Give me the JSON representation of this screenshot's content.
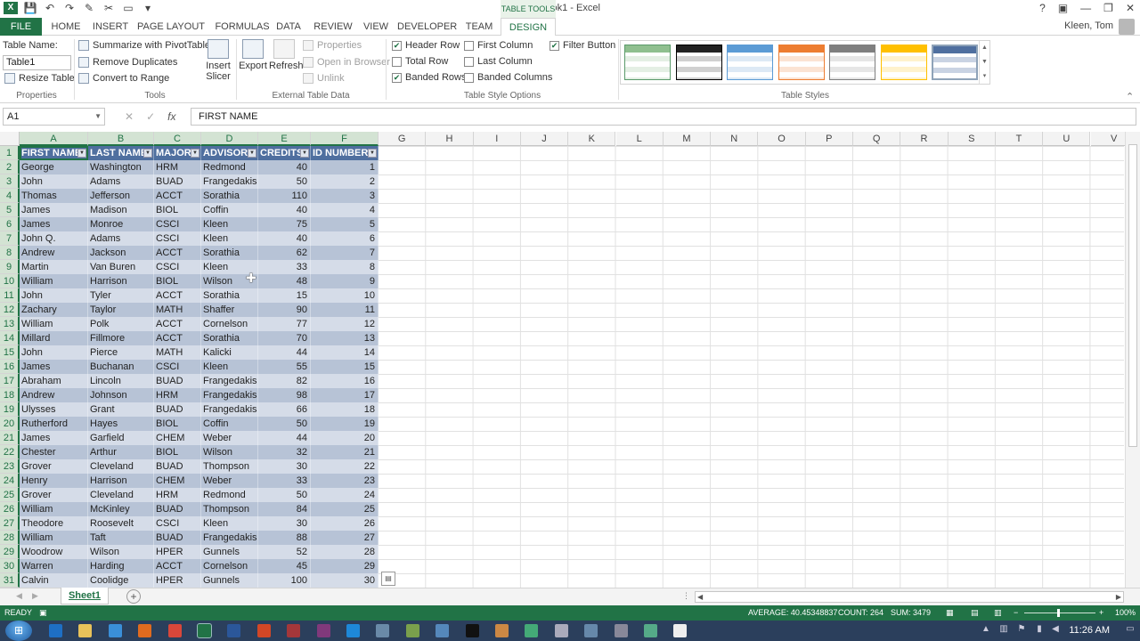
{
  "window": {
    "title": "Book1 - Excel",
    "context_group": "TABLE TOOLS",
    "user": "Kleen, Tom",
    "controls": [
      "?",
      "▣",
      "—",
      "❐",
      "✕"
    ]
  },
  "ribbon_tabs": [
    "FILE",
    "HOME",
    "INSERT",
    "PAGE LAYOUT",
    "FORMULAS",
    "DATA",
    "REVIEW",
    "VIEW",
    "DEVELOPER",
    "TEAM",
    "DESIGN"
  ],
  "active_tab": "DESIGN",
  "ribbon": {
    "properties": {
      "table_name_label": "Table Name:",
      "table_name_value": "Table1",
      "resize_label": "Resize Table",
      "group_label": "Properties"
    },
    "tools": {
      "summarize": "Summarize with PivotTable",
      "remove_duplicates": "Remove Duplicates",
      "convert": "Convert to Range",
      "insert_slicer": "Insert Slicer",
      "group_label": "Tools"
    },
    "external": {
      "export": "Export",
      "refresh": "Refresh",
      "properties": "Properties",
      "open_browser": "Open in Browser",
      "unlink": "Unlink",
      "group_label": "External Table Data"
    },
    "style_options": {
      "header_row": "Header Row",
      "total_row": "Total Row",
      "banded_rows": "Banded Rows",
      "first_column": "First Column",
      "last_column": "Last Column",
      "banded_columns": "Banded Columns",
      "filter_button": "Filter Button",
      "checked": {
        "header_row": true,
        "total_row": false,
        "banded_rows": true,
        "first_column": false,
        "last_column": false,
        "banded_columns": false,
        "filter_button": true
      },
      "group_label": "Table Style Options"
    },
    "table_styles": {
      "group_label": "Table Styles",
      "swatches": [
        {
          "head": "#8fbf8f",
          "band": "#e4efe4",
          "line": "#5a9a6a",
          "selected": false
        },
        {
          "head": "#222222",
          "band": "#d0d0d0",
          "line": "#000000",
          "selected": false
        },
        {
          "head": "#5b9bd5",
          "band": "#dde9f5",
          "line": "#5b9bd5",
          "selected": false
        },
        {
          "head": "#ed7d31",
          "band": "#fbe3d3",
          "line": "#ed7d31",
          "selected": false
        },
        {
          "head": "#7f7f7f",
          "band": "#e6e6e6",
          "line": "#7f7f7f",
          "selected": false
        },
        {
          "head": "#ffc000",
          "band": "#fff2cc",
          "line": "#ffc000",
          "selected": false
        },
        {
          "head": "#4f6f9f",
          "band": "#c9d3e3",
          "line": "#4f6f9f",
          "selected": true
        }
      ]
    }
  },
  "formula_bar": {
    "name_box": "A1",
    "formula": "FIRST NAME"
  },
  "columns": [
    "A",
    "B",
    "C",
    "D",
    "E",
    "F",
    "G",
    "H",
    "I",
    "J",
    "K",
    "L",
    "M",
    "N",
    "O",
    "P",
    "Q",
    "R",
    "S",
    "T",
    "U",
    "V"
  ],
  "table": {
    "headers": [
      "FIRST NAME",
      "LAST NAME",
      "MAJOR",
      "ADVISOR",
      "CREDITS",
      "ID NUMBER"
    ],
    "rows": [
      [
        "George",
        "Washington",
        "HRM",
        "Redmond",
        "40",
        "1"
      ],
      [
        "John",
        "Adams",
        "BUAD",
        "Frangedakis",
        "50",
        "2"
      ],
      [
        "Thomas",
        "Jefferson",
        "ACCT",
        "Sorathia",
        "110",
        "3"
      ],
      [
        "James",
        "Madison",
        "BIOL",
        "Coffin",
        "40",
        "4"
      ],
      [
        "James",
        "Monroe",
        "CSCI",
        "Kleen",
        "75",
        "5"
      ],
      [
        "John Q.",
        "Adams",
        "CSCI",
        "Kleen",
        "40",
        "6"
      ],
      [
        "Andrew",
        "Jackson",
        "ACCT",
        "Sorathia",
        "62",
        "7"
      ],
      [
        "Martin",
        "Van Buren",
        "CSCI",
        "Kleen",
        "33",
        "8"
      ],
      [
        "William",
        "Harrison",
        "BIOL",
        "Wilson",
        "48",
        "9"
      ],
      [
        "John",
        "Tyler",
        "ACCT",
        "Sorathia",
        "15",
        "10"
      ],
      [
        "Zachary",
        "Taylor",
        "MATH",
        "Shaffer",
        "90",
        "11"
      ],
      [
        "William",
        "Polk",
        "ACCT",
        "Cornelson",
        "77",
        "12"
      ],
      [
        "Millard",
        "Fillmore",
        "ACCT",
        "Sorathia",
        "70",
        "13"
      ],
      [
        "John",
        "Pierce",
        "MATH",
        "Kalicki",
        "44",
        "14"
      ],
      [
        "James",
        "Buchanan",
        "CSCI",
        "Kleen",
        "55",
        "15"
      ],
      [
        "Abraham",
        "Lincoln",
        "BUAD",
        "Frangedakis",
        "82",
        "16"
      ],
      [
        "Andrew",
        "Johnson",
        "HRM",
        "Frangedakis",
        "98",
        "17"
      ],
      [
        "Ulysses",
        "Grant",
        "BUAD",
        "Frangedakis",
        "66",
        "18"
      ],
      [
        "Rutherford",
        "Hayes",
        "BIOL",
        "Coffin",
        "50",
        "19"
      ],
      [
        "James",
        "Garfield",
        "CHEM",
        "Weber",
        "44",
        "20"
      ],
      [
        "Chester",
        "Arthur",
        "BIOL",
        "Wilson",
        "32",
        "21"
      ],
      [
        "Grover",
        "Cleveland",
        "BUAD",
        "Thompson",
        "30",
        "22"
      ],
      [
        "Henry",
        "Harrison",
        "CHEM",
        "Weber",
        "33",
        "23"
      ],
      [
        "Grover",
        "Cleveland",
        "HRM",
        "Redmond",
        "50",
        "24"
      ],
      [
        "William",
        "McKinley",
        "BUAD",
        "Thompson",
        "84",
        "25"
      ],
      [
        "Theodore",
        "Roosevelt",
        "CSCI",
        "Kleen",
        "30",
        "26"
      ],
      [
        "William",
        "Taft",
        "BUAD",
        "Frangedakis",
        "88",
        "27"
      ],
      [
        "Woodrow",
        "Wilson",
        "HPER",
        "Gunnels",
        "52",
        "28"
      ],
      [
        "Warren",
        "Harding",
        "ACCT",
        "Cornelson",
        "45",
        "29"
      ],
      [
        "Calvin",
        "Coolidge",
        "HPER",
        "Gunnels",
        "100",
        "30"
      ]
    ]
  },
  "sheet_tabs": [
    "Sheet1"
  ],
  "status": {
    "mode": "READY",
    "average": "AVERAGE: 40.45348837",
    "count": "COUNT: 264",
    "sum": "SUM: 3479",
    "zoom": "100%"
  },
  "taskbar": {
    "clock": "11:26 AM",
    "icons": [
      {
        "name": "outlook",
        "color": "#1e6fc4"
      },
      {
        "name": "folder",
        "color": "#e8c25a"
      },
      {
        "name": "ie",
        "color": "#3a8fd8"
      },
      {
        "name": "firefox",
        "color": "#e06b1f"
      },
      {
        "name": "chrome",
        "color": "#d9473a"
      },
      {
        "name": "excel",
        "color": "#217346"
      },
      {
        "name": "word",
        "color": "#2b579a"
      },
      {
        "name": "powerpoint",
        "color": "#d24726"
      },
      {
        "name": "access",
        "color": "#a4373a"
      },
      {
        "name": "onenote",
        "color": "#80397b"
      },
      {
        "name": "lync",
        "color": "#1e88d8"
      },
      {
        "name": "app-a",
        "color": "#6a8aa8"
      },
      {
        "name": "app-b",
        "color": "#7aa04c"
      },
      {
        "name": "app-c",
        "color": "#5588bb"
      },
      {
        "name": "cmd",
        "color": "#111111"
      },
      {
        "name": "app-d",
        "color": "#c84"
      },
      {
        "name": "app-e",
        "color": "#4a7"
      },
      {
        "name": "app-f",
        "color": "#aab"
      },
      {
        "name": "app-g",
        "color": "#68a"
      },
      {
        "name": "app-h",
        "color": "#889"
      },
      {
        "name": "app-i",
        "color": "#5a8"
      },
      {
        "name": "app-j",
        "color": "#eee"
      }
    ]
  }
}
